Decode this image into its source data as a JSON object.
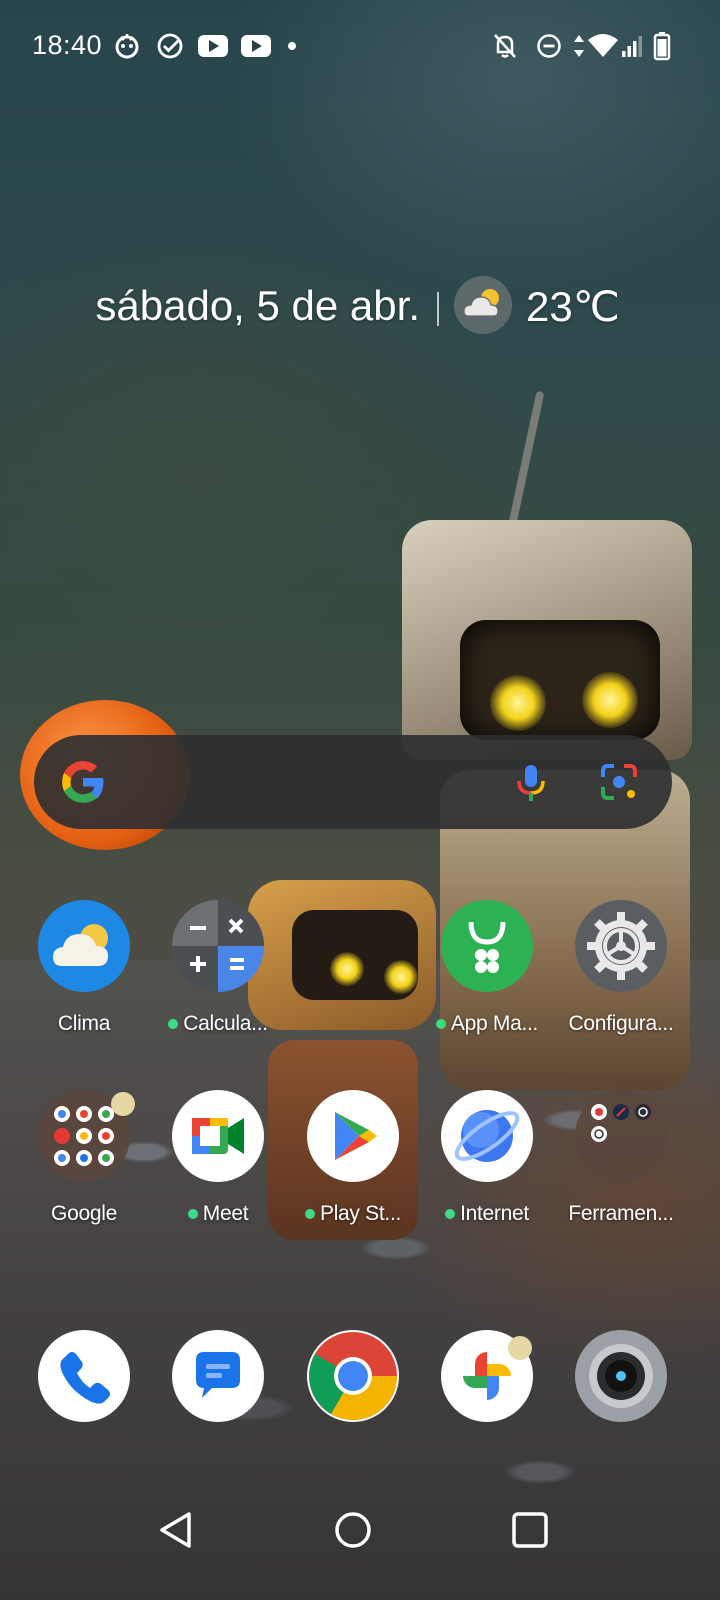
{
  "status_bar": {
    "time": "18:40",
    "left_icons": [
      "mascot-icon",
      "check-circle-icon",
      "youtube-icon",
      "youtube-icon",
      "dot-icon"
    ],
    "right_icons": [
      "notifications-off-icon",
      "do-not-disturb-icon",
      "data-arrows-icon",
      "wifi-icon",
      "signal-icon",
      "battery-icon"
    ]
  },
  "glance": {
    "date": "sábado, 5 de abr.",
    "temperature": "23℃",
    "weather_icon": "partly-cloudy-icon"
  },
  "search": {
    "icons": [
      "google-g-icon",
      "microphone-icon",
      "google-lens-icon"
    ]
  },
  "apps_row1": [
    {
      "label": "Clima",
      "icon": "weather-icon",
      "new_dot": false
    },
    {
      "label": "Calcula...",
      "icon": "calculator-icon",
      "new_dot": true
    },
    {
      "label": "",
      "icon": "",
      "new_dot": false
    },
    {
      "label": "App Ma...",
      "icon": "app-market-icon",
      "new_dot": true
    },
    {
      "label": "Configura...",
      "icon": "settings-gear-icon",
      "new_dot": false
    }
  ],
  "apps_row2": [
    {
      "label": "Google",
      "icon": "google-folder-icon",
      "new_dot": false
    },
    {
      "label": "Meet",
      "icon": "meet-icon",
      "new_dot": true
    },
    {
      "label": "Play St...",
      "icon": "play-store-icon",
      "new_dot": true
    },
    {
      "label": "Internet",
      "icon": "internet-browser-icon",
      "new_dot": true
    },
    {
      "label": "Ferramen...",
      "icon": "tools-folder-icon",
      "new_dot": false
    }
  ],
  "dock": [
    {
      "icon": "phone-icon"
    },
    {
      "icon": "messages-icon"
    },
    {
      "icon": "chrome-icon"
    },
    {
      "icon": "photos-icon"
    },
    {
      "icon": "camera-icon"
    }
  ],
  "nav": {
    "buttons": [
      "back-icon",
      "home-icon",
      "recents-icon"
    ]
  },
  "colors": {
    "new_dot": "#3ddc84",
    "search_bar_bg": "#2c2e30",
    "weather_blue": "#1e88e5",
    "settings_grey": "#5f6368"
  }
}
